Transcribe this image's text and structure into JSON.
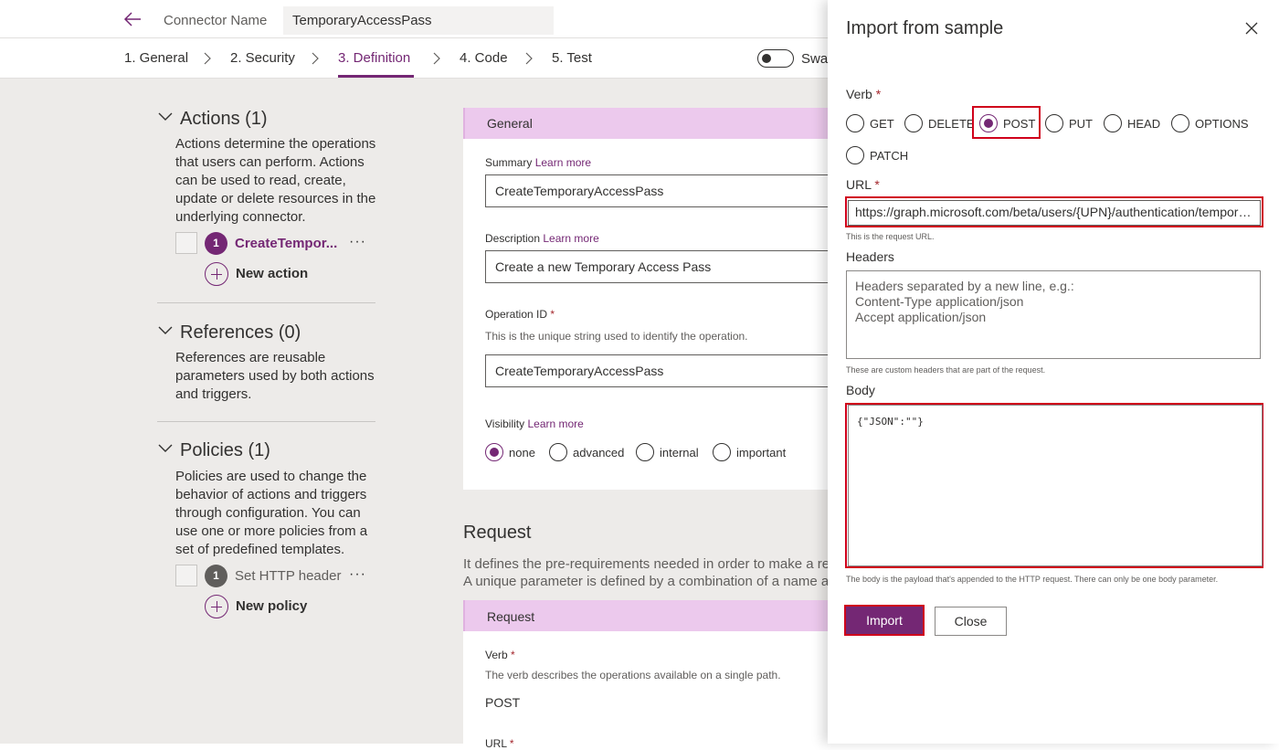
{
  "header": {
    "connector_label": "Connector Name",
    "connector_value": "TemporaryAccessPass"
  },
  "steps": [
    {
      "label": "1. General"
    },
    {
      "label": "2. Security"
    },
    {
      "label": "3. Definition",
      "active": true
    },
    {
      "label": "4. Code"
    },
    {
      "label": "5. Test"
    }
  ],
  "swagger_label": "Swag",
  "actions": {
    "title": "Actions (1)",
    "description": "Actions determine the operations that users can perform. Actions can be used to read, create, update or delete resources in the underlying connector.",
    "item_number": "1",
    "item_label": "CreateTempor...",
    "new_label": "New action"
  },
  "references": {
    "title": "References (0)",
    "description": "References are reusable parameters used by both actions and triggers."
  },
  "policies": {
    "title": "Policies (1)",
    "description": "Policies are used to change the behavior of actions and triggers through configuration. You can use one or more policies from a set of predefined templates.",
    "item_number": "1",
    "item_label": "Set HTTP header",
    "new_label": "New policy"
  },
  "general": {
    "header": "General",
    "summary_label": "Summary",
    "learn_more": "Learn more",
    "summary_value": "CreateTemporaryAccessPass",
    "description_label": "Description",
    "description_value": "Create a new Temporary Access Pass",
    "opid_label": "Operation ID",
    "required_mark": "*",
    "opid_desc": "This is the unique string used to identify the operation.",
    "opid_value": "CreateTemporaryAccessPass",
    "visibility_label": "Visibility",
    "visibility_options": [
      "none",
      "advanced",
      "internal",
      "important"
    ],
    "visibility_selected": "none"
  },
  "request": {
    "title": "Request",
    "desc_line1": "It defines the pre-requirements needed in order to make a reque",
    "desc_line2": "A unique parameter is defined by a combination of a name and l",
    "card_header": "Request",
    "verb_label": "Verb",
    "verb_desc": "The verb describes the operations available on a single path.",
    "verb_value": "POST",
    "url_label": "URL"
  },
  "import_panel": {
    "title": "Import from sample",
    "verb_label": "Verb",
    "required_mark": "*",
    "verbs": [
      "GET",
      "DELETE",
      "POST",
      "PUT",
      "HEAD",
      "OPTIONS",
      "PATCH"
    ],
    "verb_selected": "POST",
    "url_label": "URL",
    "url_value": "https://graph.microsoft.com/beta/users/{UPN}/authentication/temporaryAccessPassMethods",
    "url_hint": "This is the request URL.",
    "headers_label": "Headers",
    "headers_placeholder_1": "Headers separated by a new line, e.g.:",
    "headers_placeholder_2": "Content-Type application/json",
    "headers_placeholder_3": "Accept application/json",
    "headers_hint": "These are custom headers that are part of the request.",
    "body_label": "Body",
    "body_value": "{\"JSON\":\"\"}",
    "body_hint": "The body is the payload that's appended to the HTTP request. There can only be one body parameter.",
    "import_button": "Import",
    "close_button": "Close"
  },
  "colors": {
    "accent": "#742774",
    "section_header": "#ecc9ed",
    "highlight": "#d0021b",
    "background": "#edebe9"
  }
}
